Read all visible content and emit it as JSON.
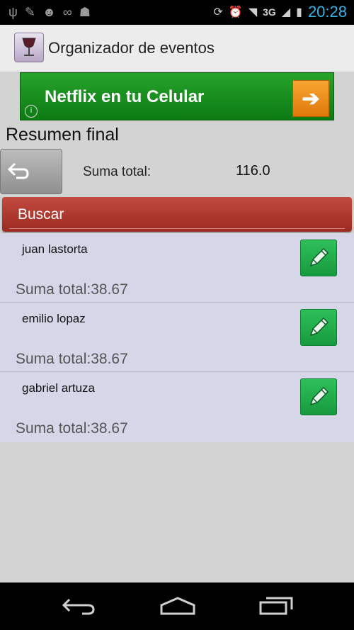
{
  "status_bar": {
    "time": "20:28",
    "network": "3G",
    "left_icons": [
      "usb-icon",
      "cleaner-icon",
      "android-icon",
      "voicemail-icon",
      "gamepad-icon"
    ],
    "right_icons": [
      "rotate-icon",
      "alarm-icon",
      "wifi-icon",
      "signal-icon",
      "battery-icon"
    ]
  },
  "action_bar": {
    "title": "Organizador de eventos",
    "icon": "wine-glass-icon"
  },
  "ad": {
    "text": "Netflix en tu Celular",
    "info": "i"
  },
  "summary": {
    "title": "Resumen final",
    "total_label": "Suma total:",
    "total_value": "116.0"
  },
  "search": {
    "label": "Buscar"
  },
  "people": [
    {
      "name": "juan lastorta",
      "sum": "Suma total:38.67"
    },
    {
      "name": "emilio lopaz",
      "sum": "Suma total:38.67"
    },
    {
      "name": "gabriel artuza",
      "sum": "Suma total:38.67"
    }
  ],
  "colors": {
    "accent_red": "#b03a2e",
    "ad_green": "#1a8f20",
    "edit_green": "#22ad4c",
    "list_bg": "#d5d6e8",
    "time_blue": "#33b5e5"
  }
}
